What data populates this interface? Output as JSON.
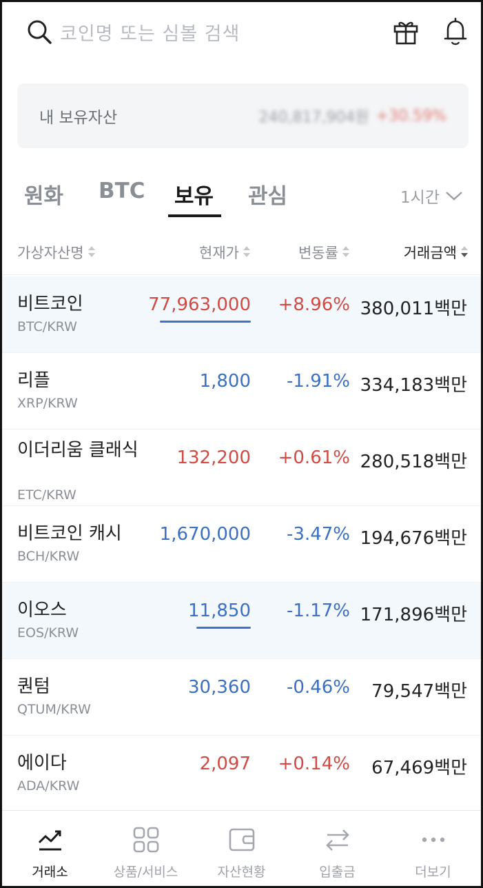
{
  "search": {
    "placeholder": "코인명 또는 심볼 검색",
    "icon": "search-icon",
    "actions": [
      {
        "name": "gift-icon"
      },
      {
        "name": "bell-icon"
      }
    ]
  },
  "assets": {
    "label": "내 보유자산",
    "amount": "240,817,904원",
    "change": "+30.59%"
  },
  "tabs": [
    {
      "label": "원화"
    },
    {
      "label": "BTC"
    },
    {
      "label": "보유"
    },
    {
      "label": "관심"
    }
  ],
  "active_tab": "보유",
  "period": {
    "label": "1시간",
    "icon": "chevron-down-icon"
  },
  "columns": {
    "name": "가상자산명",
    "price": "현재가",
    "change": "변동률",
    "volume": "거래금액"
  },
  "rows": [
    {
      "name": "비트코인",
      "pair": "BTC/KRW",
      "price": "77,963,000",
      "change": "+8.96%",
      "volume": "380,011백만",
      "trend": "up",
      "highlight": true
    },
    {
      "name": "리플",
      "pair": "XRP/KRW",
      "price": "1,800",
      "change": "-1.91%",
      "volume": "334,183백만",
      "trend": "down",
      "highlight": false
    },
    {
      "name": "이더리움 클래식",
      "pair": "ETC/KRW",
      "price": "132,200",
      "change": "+0.61%",
      "volume": "280,518백만",
      "trend": "up",
      "highlight": false
    },
    {
      "name": "비트코인 캐시",
      "pair": "BCH/KRW",
      "price": "1,670,000",
      "change": "-3.47%",
      "volume": "194,676백만",
      "trend": "down",
      "highlight": false
    },
    {
      "name": "이오스",
      "pair": "EOS/KRW",
      "price": "11,850",
      "change": "-1.17%",
      "volume": "171,896백만",
      "trend": "down",
      "highlight": true
    },
    {
      "name": "퀀텀",
      "pair": "QTUM/KRW",
      "price": "30,360",
      "change": "-0.46%",
      "volume": "79,547백만",
      "trend": "down",
      "highlight": false
    },
    {
      "name": "에이다",
      "pair": "ADA/KRW",
      "price": "2,097",
      "change": "+0.14%",
      "volume": "67,469백만",
      "trend": "up",
      "highlight": false
    }
  ],
  "nav": [
    {
      "label": "거래소",
      "icon": "chart-trend-icon",
      "active": true
    },
    {
      "label": "상품/서비스",
      "icon": "grid-icon",
      "active": false
    },
    {
      "label": "자산현황",
      "icon": "wallet-icon",
      "active": false
    },
    {
      "label": "입출금",
      "icon": "transfer-icon",
      "active": false
    },
    {
      "label": "더보기",
      "icon": "more-icon",
      "active": false
    }
  ],
  "colors": {
    "up": "#d24a43",
    "down": "#3a6fc4",
    "highlight": "#f3f8fd"
  }
}
